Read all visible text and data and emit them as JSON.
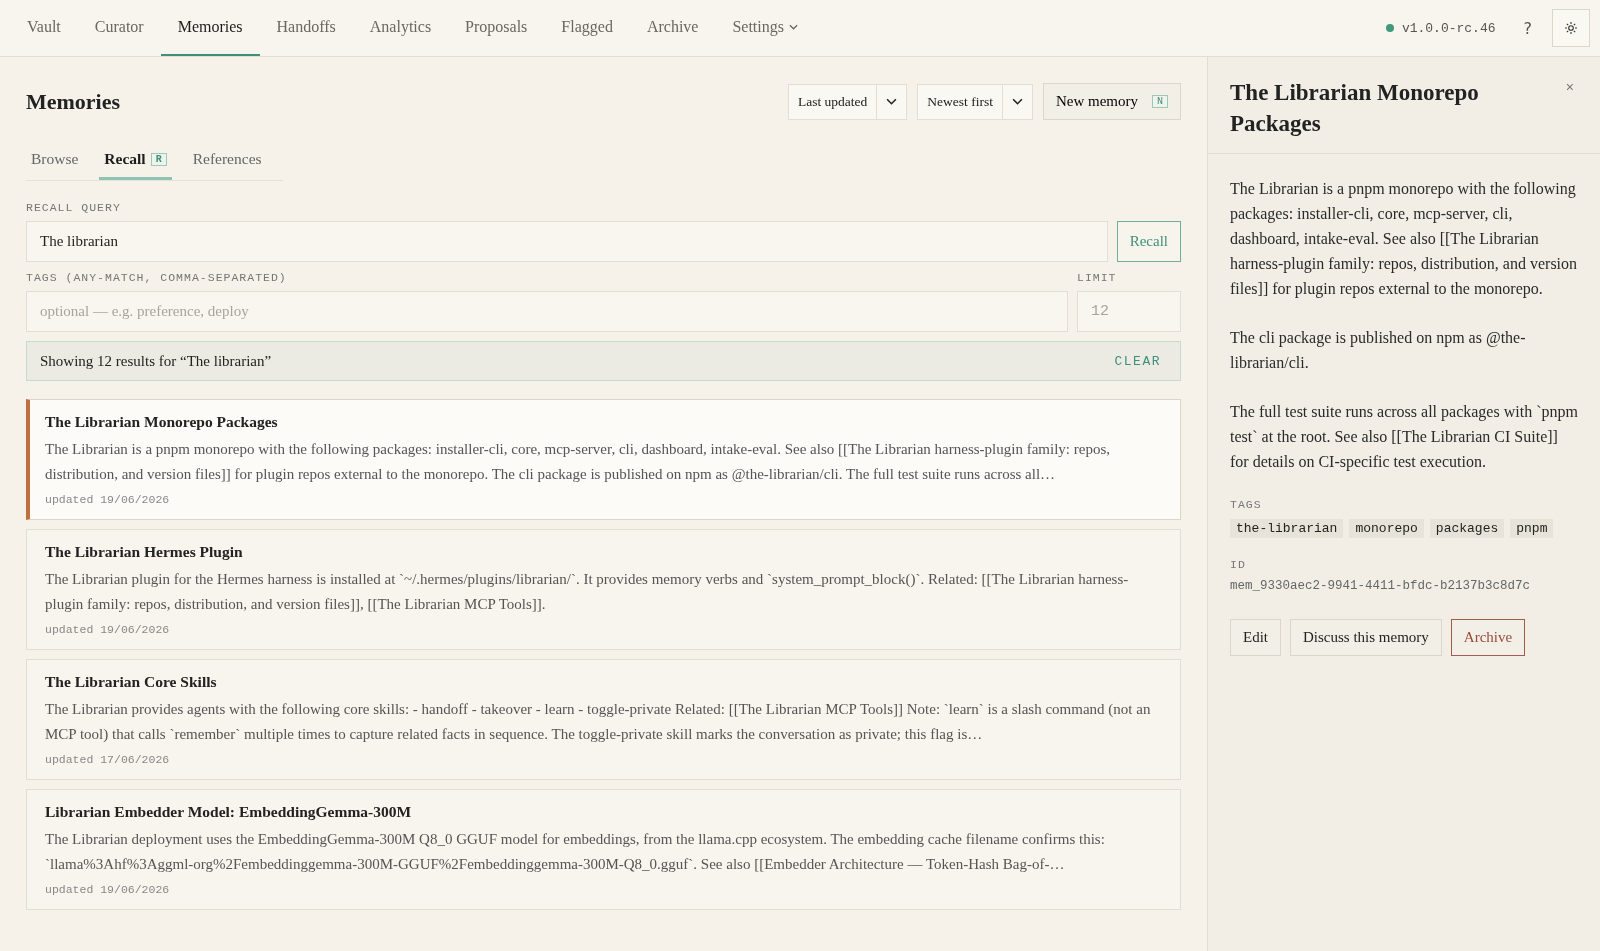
{
  "nav": {
    "items": [
      {
        "label": "Vault",
        "selected": false
      },
      {
        "label": "Curator",
        "selected": false
      },
      {
        "label": "Memories",
        "selected": true
      },
      {
        "label": "Handoffs",
        "selected": false
      },
      {
        "label": "Analytics",
        "selected": false
      },
      {
        "label": "Proposals",
        "selected": false
      },
      {
        "label": "Flagged",
        "selected": false
      },
      {
        "label": "Archive",
        "selected": false
      },
      {
        "label": "Settings",
        "selected": false,
        "kind": "menu"
      }
    ],
    "version": "v1.0.0-rc.46",
    "help": "?"
  },
  "page": {
    "title": "Memories",
    "sort_field": "Last updated",
    "sort_order": "Newest first",
    "new_button": "New memory",
    "new_key": "N"
  },
  "tabs": [
    {
      "label": "Browse",
      "selected": false
    },
    {
      "label": "Recall",
      "selected": true,
      "key": "R"
    },
    {
      "label": "References",
      "selected": false
    }
  ],
  "recall": {
    "query_label": "RECALL QUERY",
    "query": "The librarian",
    "button": "Recall",
    "tags_label": "TAGS (ANY-MATCH, COMMA-SEPARATED)",
    "tags_placeholder": "optional — e.g. preference, deploy",
    "limit_label": "LIMIT",
    "limit_placeholder": "12"
  },
  "results_banner": {
    "text": "Showing 12 results for “The librarian”",
    "clear": "CLEAR"
  },
  "results": [
    {
      "title": "The Librarian Monorepo Packages",
      "selected": true,
      "body": "The Librarian is a pnpm monorepo with the following packages: installer-cli, core, mcp-server, cli, dashboard, intake-eval. See also [[The Librarian harness-plugin family: repos, distribution, and version files]] for plugin repos external to the monorepo. The cli package is published on npm as @the-librarian/cli. The full test suite runs across all…",
      "updated": "updated 19/06/2026"
    },
    {
      "title": "The Librarian Hermes Plugin",
      "selected": false,
      "body": "The Librarian plugin for the Hermes harness is installed at `~/.hermes/plugins/librarian/`. It provides memory verbs and `system_prompt_block()`. Related: [[The Librarian harness-plugin family: repos, distribution, and version files]], [[The Librarian MCP Tools]].",
      "updated": "updated 19/06/2026"
    },
    {
      "title": "The Librarian Core Skills",
      "selected": false,
      "body": "The Librarian provides agents with the following core skills: - handoff - takeover - learn - toggle-private Related: [[The Librarian MCP Tools]] Note: `learn` is a slash command (not an MCP tool) that calls `remember` multiple times to capture related facts in sequence. The toggle-private skill marks the conversation as private; this flag is…",
      "updated": "updated 17/06/2026"
    },
    {
      "title": "Librarian Embedder Model: EmbeddingGemma-300M",
      "selected": false,
      "body": "The Librarian deployment uses the EmbeddingGemma-300M Q8_0 GGUF model for embeddings, from the llama.cpp ecosystem. The embedding cache filename confirms this: `llama%3Ahf%3Aggml-org%2Fembeddinggemma-300M-GGUF%2Fembeddinggemma-300M-Q8_0.gguf`. See also [[Embedder Architecture — Token-Hash Bag-of-…",
      "updated": "updated 19/06/2026"
    }
  ],
  "detail": {
    "title": "The Librarian Monorepo Packages",
    "close": "×",
    "paragraphs": [
      "The Librarian is a pnpm monorepo with the following packages: installer-cli, core, mcp-server, cli, dashboard, intake-eval. See also [[The Librarian harness-plugin family: repos, distribution, and version files]] for plugin repos external to the monorepo.",
      "The cli package is published on npm as @the-librarian/cli.",
      "The full test suite runs across all packages with `pnpm test` at the root. See also [[The Librarian CI Suite]] for details on CI-specific test execution."
    ],
    "tags_label": "TAGS",
    "tags": [
      "the-librarian",
      "monorepo",
      "packages",
      "pnpm"
    ],
    "id_label": "ID",
    "id": "mem_9330aec2-9941-4411-bfdc-b2137b3c8d7c",
    "actions": [
      {
        "label": "Edit",
        "kind": "plain"
      },
      {
        "label": "Discuss this memory",
        "kind": "plain"
      },
      {
        "label": "Archive",
        "kind": "danger"
      }
    ]
  }
}
